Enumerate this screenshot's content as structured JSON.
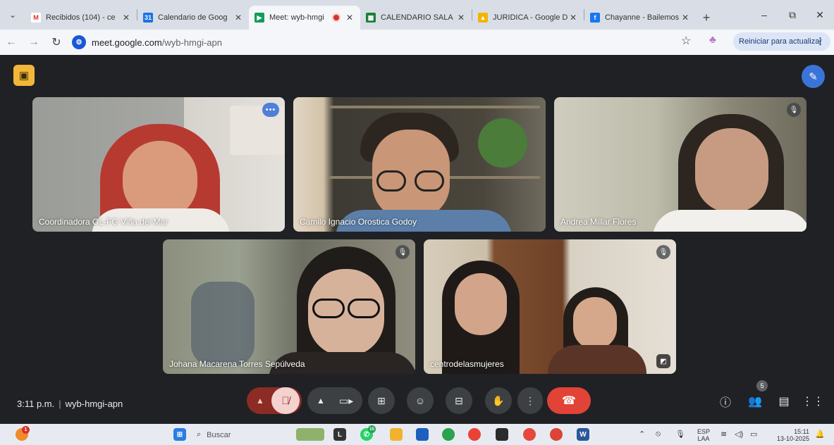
{
  "browser": {
    "tabs": [
      {
        "label": "Recibidos (104) - ce",
        "icon": "gmail-icon",
        "color": "#d93025",
        "active": false
      },
      {
        "label": "Calendario de Goog",
        "icon": "calendar-icon",
        "color": "#1a73e8",
        "active": false
      },
      {
        "label": "Meet: wyb-hmgi",
        "icon": "meet-icon",
        "color": "#0f9d58",
        "active": true
      },
      {
        "label": "CALENDARIO SALA",
        "icon": "sheets-icon",
        "color": "#188038",
        "active": false
      },
      {
        "label": "JURIDICA - Google D",
        "icon": "drive-icon",
        "color": "#f4b400",
        "active": false
      },
      {
        "label": "Chayanne - Bailemos",
        "icon": "facebook-icon",
        "color": "#1877f2",
        "active": false
      }
    ],
    "url_host": "meet.google.com",
    "url_path": "/wyb-hmgi-apn",
    "update_label": "Reiniciar para actualizar"
  },
  "meet": {
    "participants": [
      {
        "name": "Coordinadora OL-FG Viña del Mar",
        "indicator": "speaking"
      },
      {
        "name": "Camilo Ignacio Orostica Godoy",
        "indicator": "none"
      },
      {
        "name": "Andrea Millar Flores",
        "indicator": "muted"
      },
      {
        "name": "Johana Macarena Torres Sepúlveda",
        "indicator": "muted"
      },
      {
        "name": "centrodelasmujeres",
        "indicator": "muted"
      }
    ],
    "time": "3:11 p.m.",
    "meeting_code": "wyb-hmgi-apn",
    "participant_count": "5"
  },
  "taskbar": {
    "search_placeholder": "Buscar",
    "weather_badge": "1",
    "whatsapp_badge": "15",
    "lang_top": "ESP",
    "lang_bottom": "LAA",
    "time": "15:11",
    "date": "13-10-2025"
  }
}
